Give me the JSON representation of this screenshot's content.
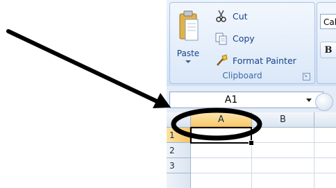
{
  "clipboard": {
    "paste_label": "Paste",
    "cut_label": "Cut",
    "copy_label": "Copy",
    "format_painter_label": "Format Painter",
    "group_label": "Clipboard"
  },
  "font": {
    "font_name_value": "Cal",
    "bold_label": "B"
  },
  "formula_bar": {
    "name_box_value": "A1"
  },
  "grid": {
    "columns": [
      "A",
      "B"
    ],
    "rows": [
      "1",
      "2",
      "3"
    ],
    "active_cell": "A1"
  },
  "colors": {
    "selected_header": "#f8c96a",
    "ribbon_text": "#15428b",
    "annotation": "#000000"
  }
}
